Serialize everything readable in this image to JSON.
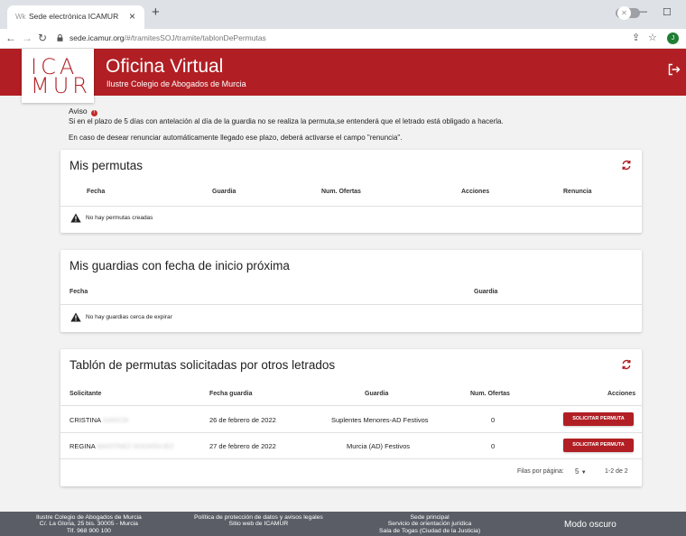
{
  "browser": {
    "tab_title": "Sede electrónica ICAMUR",
    "tab_close": "×",
    "new_tab": "+",
    "url_host": "sede.icamur.org",
    "url_path": "/#/tramitesSOJ/tramite/tablonDePermutas",
    "profile_initial": "J",
    "back": "←",
    "forward": "→",
    "reload": "↻",
    "share": "⇪",
    "star": "☆",
    "min": "—",
    "max": "☐",
    "collapse": "⌄"
  },
  "header": {
    "logo_top": "ICA",
    "logo_bottom": "MUR",
    "title": "Oficina Virtual",
    "subtitle": "Ilustre Colegio de Abogados de Murcia"
  },
  "notice": {
    "title": "Aviso",
    "line1": "Si en el plazo de 5 días con antelación al día de la guardia no se realiza la permuta,se entenderá que el letrado está obligado a hacerla.",
    "line2": "En caso de desear renunciar automáticamente llegado ese plazo, deberá activarse el campo \"renuncia\"."
  },
  "mis_permutas": {
    "title": "Mis permutas",
    "columns": [
      "Fecha",
      "Guardia",
      "Num. Ofertas",
      "Acciones",
      "Renuncia"
    ],
    "empty": "No hay permutas creadas"
  },
  "mis_guardias": {
    "title": "Mis guardias con fecha de inicio próxima",
    "columns": [
      "Fecha",
      "Guardia"
    ],
    "empty": "No hay guardias cerca de expirar"
  },
  "tablon": {
    "title": "Tablón de permutas solicitadas por otros letrados",
    "columns": [
      "Solicitante",
      "Fecha guardia",
      "Guardia",
      "Num. Ofertas",
      "Acciones"
    ],
    "rows": [
      {
        "solicitante": "CRISTINA",
        "solicitante_blur": "GARCÍA",
        "fecha": "26 de febrero de 2022",
        "guardia": "Suplentes Menores-AD Festivos",
        "ofertas": "0",
        "accion": "SOLICITAR PERMUTA"
      },
      {
        "solicitante": "REGINA",
        "solicitante_blur": "MARTÍNEZ RODRÍGUEZ",
        "fecha": "27 de febrero de 2022",
        "guardia": "Murcia (AD) Festivos",
        "ofertas": "0",
        "accion": "SOLICITAR PERMUTA"
      }
    ],
    "pagination": {
      "label": "Filas por página:",
      "per_page": "5",
      "range": "1-2 de 2"
    }
  },
  "footer": {
    "col1": [
      "Ilustre Colegio de Abogados de Murcia",
      "C/. La Gloria, 25 bis. 30005 - Murcia",
      "Tlf. 968 900 100"
    ],
    "col2": [
      "Política de protección de datos y avisos legales",
      "Sitio web de ICAMUR"
    ],
    "col3": [
      "Sede principal",
      "Servicio de orientación jurídica",
      "Sala de Togas (Ciudad de la Justicia)"
    ],
    "dark_mode_label": "Modo oscuro",
    "dark_mode_on": false
  },
  "colors": {
    "brand": "#b11f24",
    "footer": "#5a5d66",
    "background": "#f2f2f2"
  }
}
